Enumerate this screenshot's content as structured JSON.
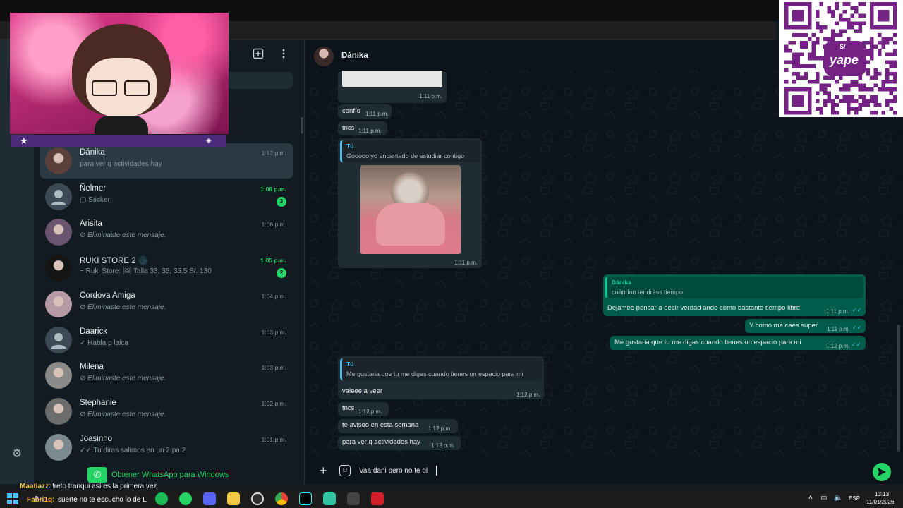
{
  "header": {
    "contact_name": "Dánika"
  },
  "sidebar": {
    "chats": [
      {
        "name": "Dánika",
        "preview": "para ver q actividades hay",
        "time": "1:12 p.m.",
        "unread": false,
        "badge": "",
        "preview_icon": ""
      },
      {
        "name": "Ñelmer",
        "preview": "Sticker",
        "time": "1:08 p.m.",
        "unread": true,
        "badge": "3",
        "preview_icon": "sticker-icon"
      },
      {
        "name": "Arisita",
        "preview": "Eliminaste este mensaje.",
        "time": "1:06 p.m.",
        "unread": false,
        "badge": "",
        "preview_icon": "deleted-icon"
      },
      {
        "name": "RUKI STORE 2 🌑",
        "preview": "~ Ruki Store: 🖼 Talla 33, 35, 35.5 S/. 130",
        "time": "1:05 p.m.",
        "unread": true,
        "badge": "2",
        "preview_icon": ""
      },
      {
        "name": "Cordova Amiga",
        "preview": "Eliminaste este mensaje.",
        "time": "1:04 p.m.",
        "unread": false,
        "badge": "",
        "preview_icon": "deleted-icon"
      },
      {
        "name": "Daarick",
        "preview": "Habla p laica",
        "time": "1:03 p.m.",
        "unread": false,
        "badge": "",
        "preview_icon": "check-icon"
      },
      {
        "name": "Milena",
        "preview": "Eliminaste este mensaje.",
        "time": "1:03 p.m.",
        "unread": false,
        "badge": "",
        "preview_icon": "deleted-icon"
      },
      {
        "name": "Stephanie",
        "preview": "Eliminaste este mensaje.",
        "time": "1:02 p.m.",
        "unread": false,
        "badge": "",
        "preview_icon": "deleted-icon"
      },
      {
        "name": "Joasinho",
        "preview": "Tu diras salimos en un 2 pa 2",
        "time": "1:01 p.m.",
        "unread": false,
        "badge": "",
        "preview_icon": "double-check-icon"
      }
    ],
    "get_app_label": "Obtener WhatsApp para Windows"
  },
  "messages": {
    "m0_time": "1:11 p.m.",
    "m1_text": "confío",
    "m1_time": "1:11 p.m.",
    "m2_text": "tncs",
    "m2_time": "1:11 p.m.",
    "m3_quote_name": "Tú",
    "m3_quote_text": "Gooooo yo encantado de estudiar contigo",
    "m3_time": "1:11 p.m.",
    "m4_quote_name": "Dánika",
    "m4_quote_text": "cuándoo tendráss tiempo",
    "m4_text": "Dejamee pensar a decir verdad ando como bastante tiempo libre",
    "m4_time": "1:11 p.m.",
    "m5_text": "Y como me caes super",
    "m5_time": "1:11 p.m.",
    "m6_text": "Me gustaria que tu me digas cuando tienes un espacio para mi",
    "m6_time": "1:12 p.m.",
    "m7_quote_name": "Tú",
    "m7_quote_text": "Me gustaria que tu me digas cuando tienes un espacio para mi",
    "m7_text": "valeee a veer",
    "m7_time": "1:12 p.m.",
    "m8_text": "tncs",
    "m8_time": "1:12 p.m.",
    "m9_text": "te avisoo en esta semana",
    "m9_time": "1:12 p.m.",
    "m10_text": "para ver q actividades hay",
    "m10_time": "1:12 p.m."
  },
  "composer": {
    "input_value": "Vaa dani pero no te ol"
  },
  "stream_overlay": {
    "chat_line_1_user": "Maatiazz:",
    "chat_line_1_text": "!reto tranqui así es la primera vez",
    "chat_line_2_user": "Fabri1q:",
    "chat_line_2_text": "suerte no te escucho lo de L",
    "qr_brand": "yape",
    "qr_currency": "S/"
  },
  "taskbar": {
    "language": "ESP",
    "clock_time": "13:13",
    "clock_date": "11/01/2026"
  },
  "colors": {
    "accent_green": "#25d366",
    "outgoing_bubble": "#005c4b",
    "incoming_bubble": "#202c33",
    "yape_purple": "#742384"
  }
}
